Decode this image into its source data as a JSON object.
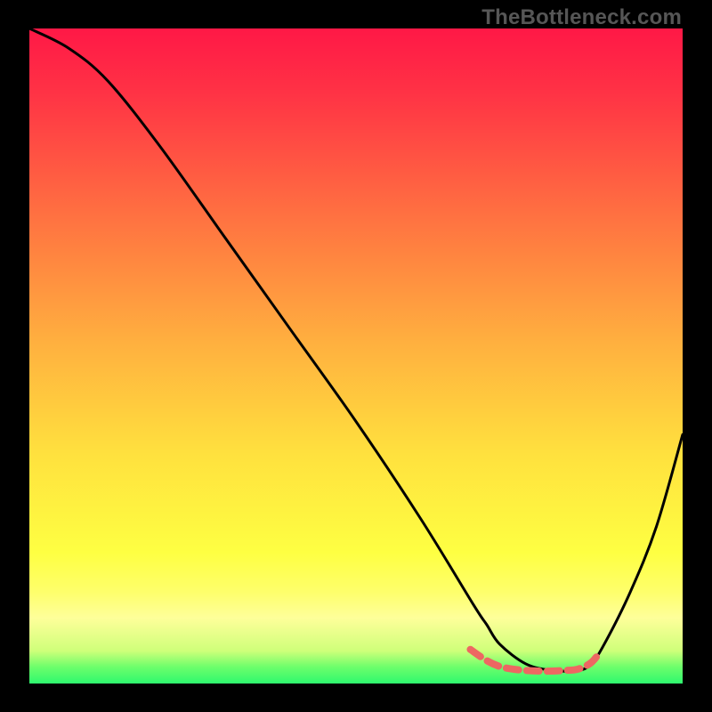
{
  "watermark": "TheBottleneck.com",
  "chart_data": {
    "type": "line",
    "title": "",
    "xlabel": "",
    "ylabel": "",
    "xlim": [
      0,
      100
    ],
    "ylim": [
      0,
      100
    ],
    "grid": false,
    "gradient_stops": [
      {
        "offset": 0.0,
        "color": "#ff1846"
      },
      {
        "offset": 0.1,
        "color": "#ff3345"
      },
      {
        "offset": 0.28,
        "color": "#ff6f41"
      },
      {
        "offset": 0.48,
        "color": "#ffb03f"
      },
      {
        "offset": 0.65,
        "color": "#ffe13e"
      },
      {
        "offset": 0.8,
        "color": "#feff42"
      },
      {
        "offset": 0.86,
        "color": "#feff6b"
      },
      {
        "offset": 0.9,
        "color": "#feff9a"
      },
      {
        "offset": 0.95,
        "color": "#cfff7a"
      },
      {
        "offset": 0.975,
        "color": "#6cfe6b"
      },
      {
        "offset": 1.0,
        "color": "#2ef86e"
      }
    ],
    "series": [
      {
        "name": "main-curve",
        "color": "#000000",
        "x": [
          0,
          6,
          12,
          20,
          30,
          40,
          50,
          60,
          68,
          70,
          72,
          76,
          80,
          84,
          86,
          88,
          92,
          96,
          100
        ],
        "y": [
          100,
          97,
          92,
          82,
          68,
          54,
          40,
          25,
          12,
          9,
          6,
          3,
          2,
          2,
          3,
          6,
          14,
          24,
          38
        ]
      },
      {
        "name": "floor-highlight",
        "color": "#ed6762",
        "x": [
          67.5,
          70,
          72,
          74,
          76,
          78,
          80,
          82,
          84,
          86,
          87.5
        ],
        "y": [
          5.2,
          3.5,
          2.6,
          2.2,
          2.0,
          1.9,
          1.9,
          2.0,
          2.2,
          3.2,
          5.0
        ]
      }
    ]
  }
}
